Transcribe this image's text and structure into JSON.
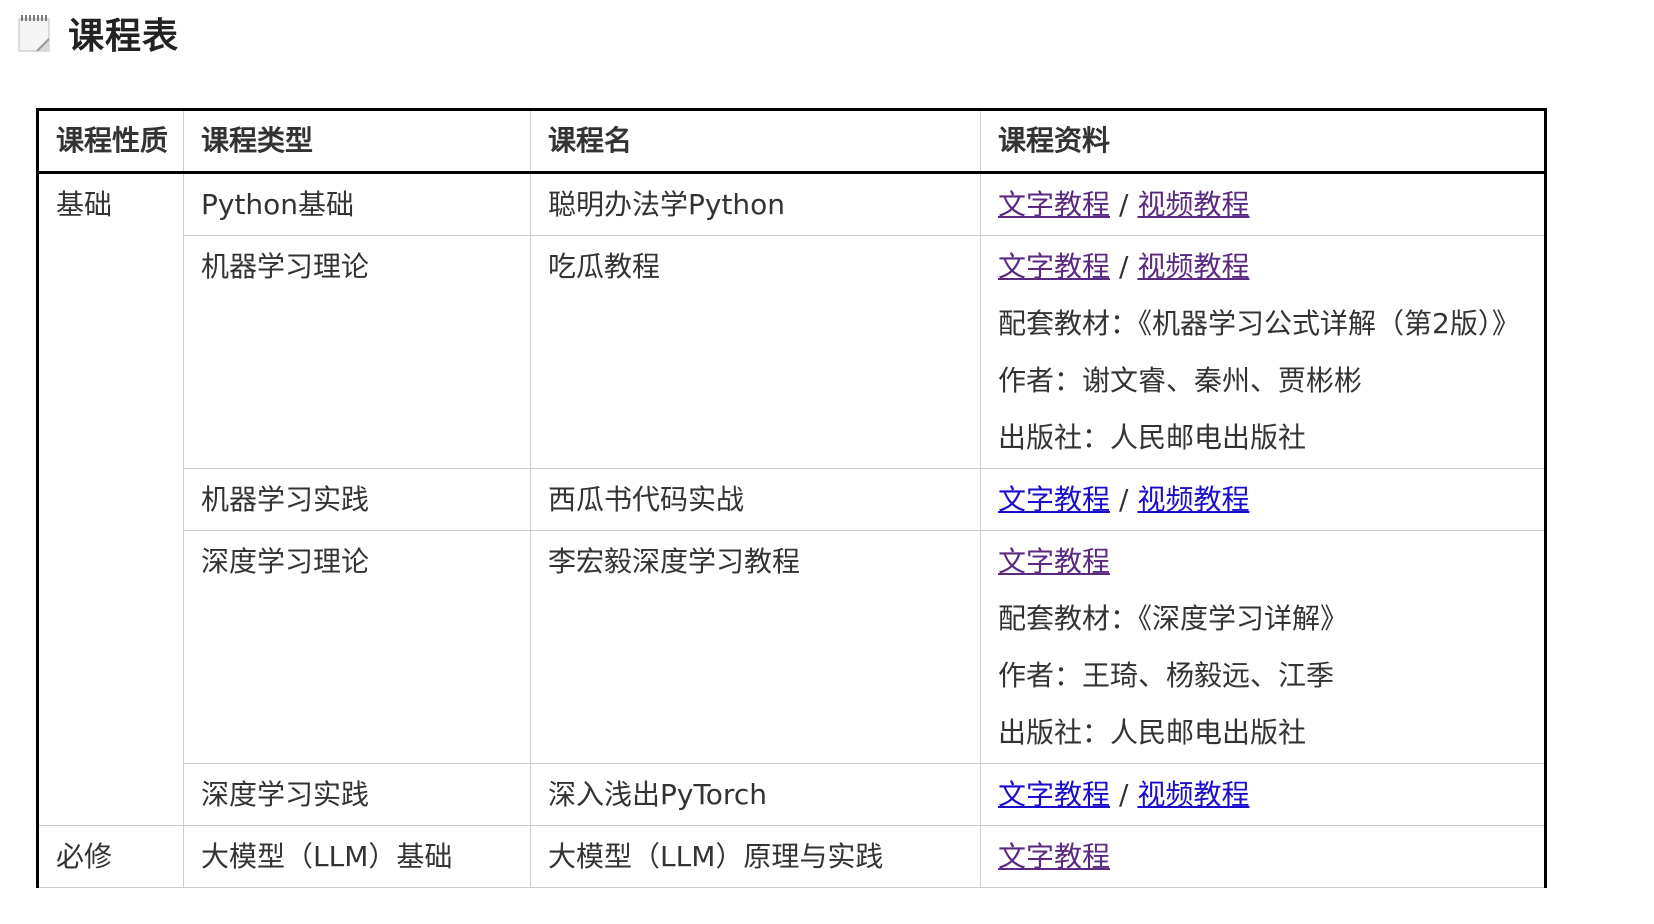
{
  "page": {
    "icon": "notepad-icon",
    "title": "课程表"
  },
  "colors": {
    "visited_link": "#5a2a82",
    "link": "#1a0dcc",
    "border": "#000000",
    "text": "#333333"
  },
  "table": {
    "headers": [
      "课程性质",
      "课程类型",
      "课程名",
      "课程资料"
    ],
    "rows": [
      {
        "category": "基础",
        "type": "Python基础",
        "name": "聪明办法学Python",
        "links": [
          {
            "label": "文字教程",
            "visited": true
          },
          {
            "label": "视频教程",
            "visited": true
          }
        ],
        "separator": "/",
        "notes": []
      },
      {
        "category": "",
        "type": "机器学习理论",
        "name": "吃瓜教程",
        "links": [
          {
            "label": "文字教程",
            "visited": true
          },
          {
            "label": "视频教程",
            "visited": true
          }
        ],
        "separator": "/",
        "notes": [
          "配套教材：《机器学习公式详解（第2版）》",
          "作者：谢文睿、秦州、贾彬彬",
          "出版社：人民邮电出版社"
        ]
      },
      {
        "category": "",
        "type": "机器学习实践",
        "name": "西瓜书代码实战",
        "links": [
          {
            "label": "文字教程",
            "visited": false
          },
          {
            "label": "视频教程",
            "visited": false
          }
        ],
        "separator": "/",
        "notes": []
      },
      {
        "category": "",
        "type": "深度学习理论",
        "name": "李宏毅深度学习教程",
        "links": [
          {
            "label": "文字教程",
            "visited": true
          }
        ],
        "separator": "",
        "notes": [
          "配套教材：《深度学习详解》",
          "作者：王琦、杨毅远、江季",
          "出版社：人民邮电出版社"
        ]
      },
      {
        "category": "",
        "type": "深度学习实践",
        "name": "深入浅出PyTorch",
        "links": [
          {
            "label": "文字教程",
            "visited": false
          },
          {
            "label": "视频教程",
            "visited": false
          }
        ],
        "separator": "/",
        "notes": []
      },
      {
        "category": "必修",
        "type": "大模型（LLM）基础",
        "name": "大模型（LLM）原理与实践",
        "links": [
          {
            "label": "文字教程",
            "visited": true
          }
        ],
        "separator": "",
        "notes": []
      }
    ]
  }
}
